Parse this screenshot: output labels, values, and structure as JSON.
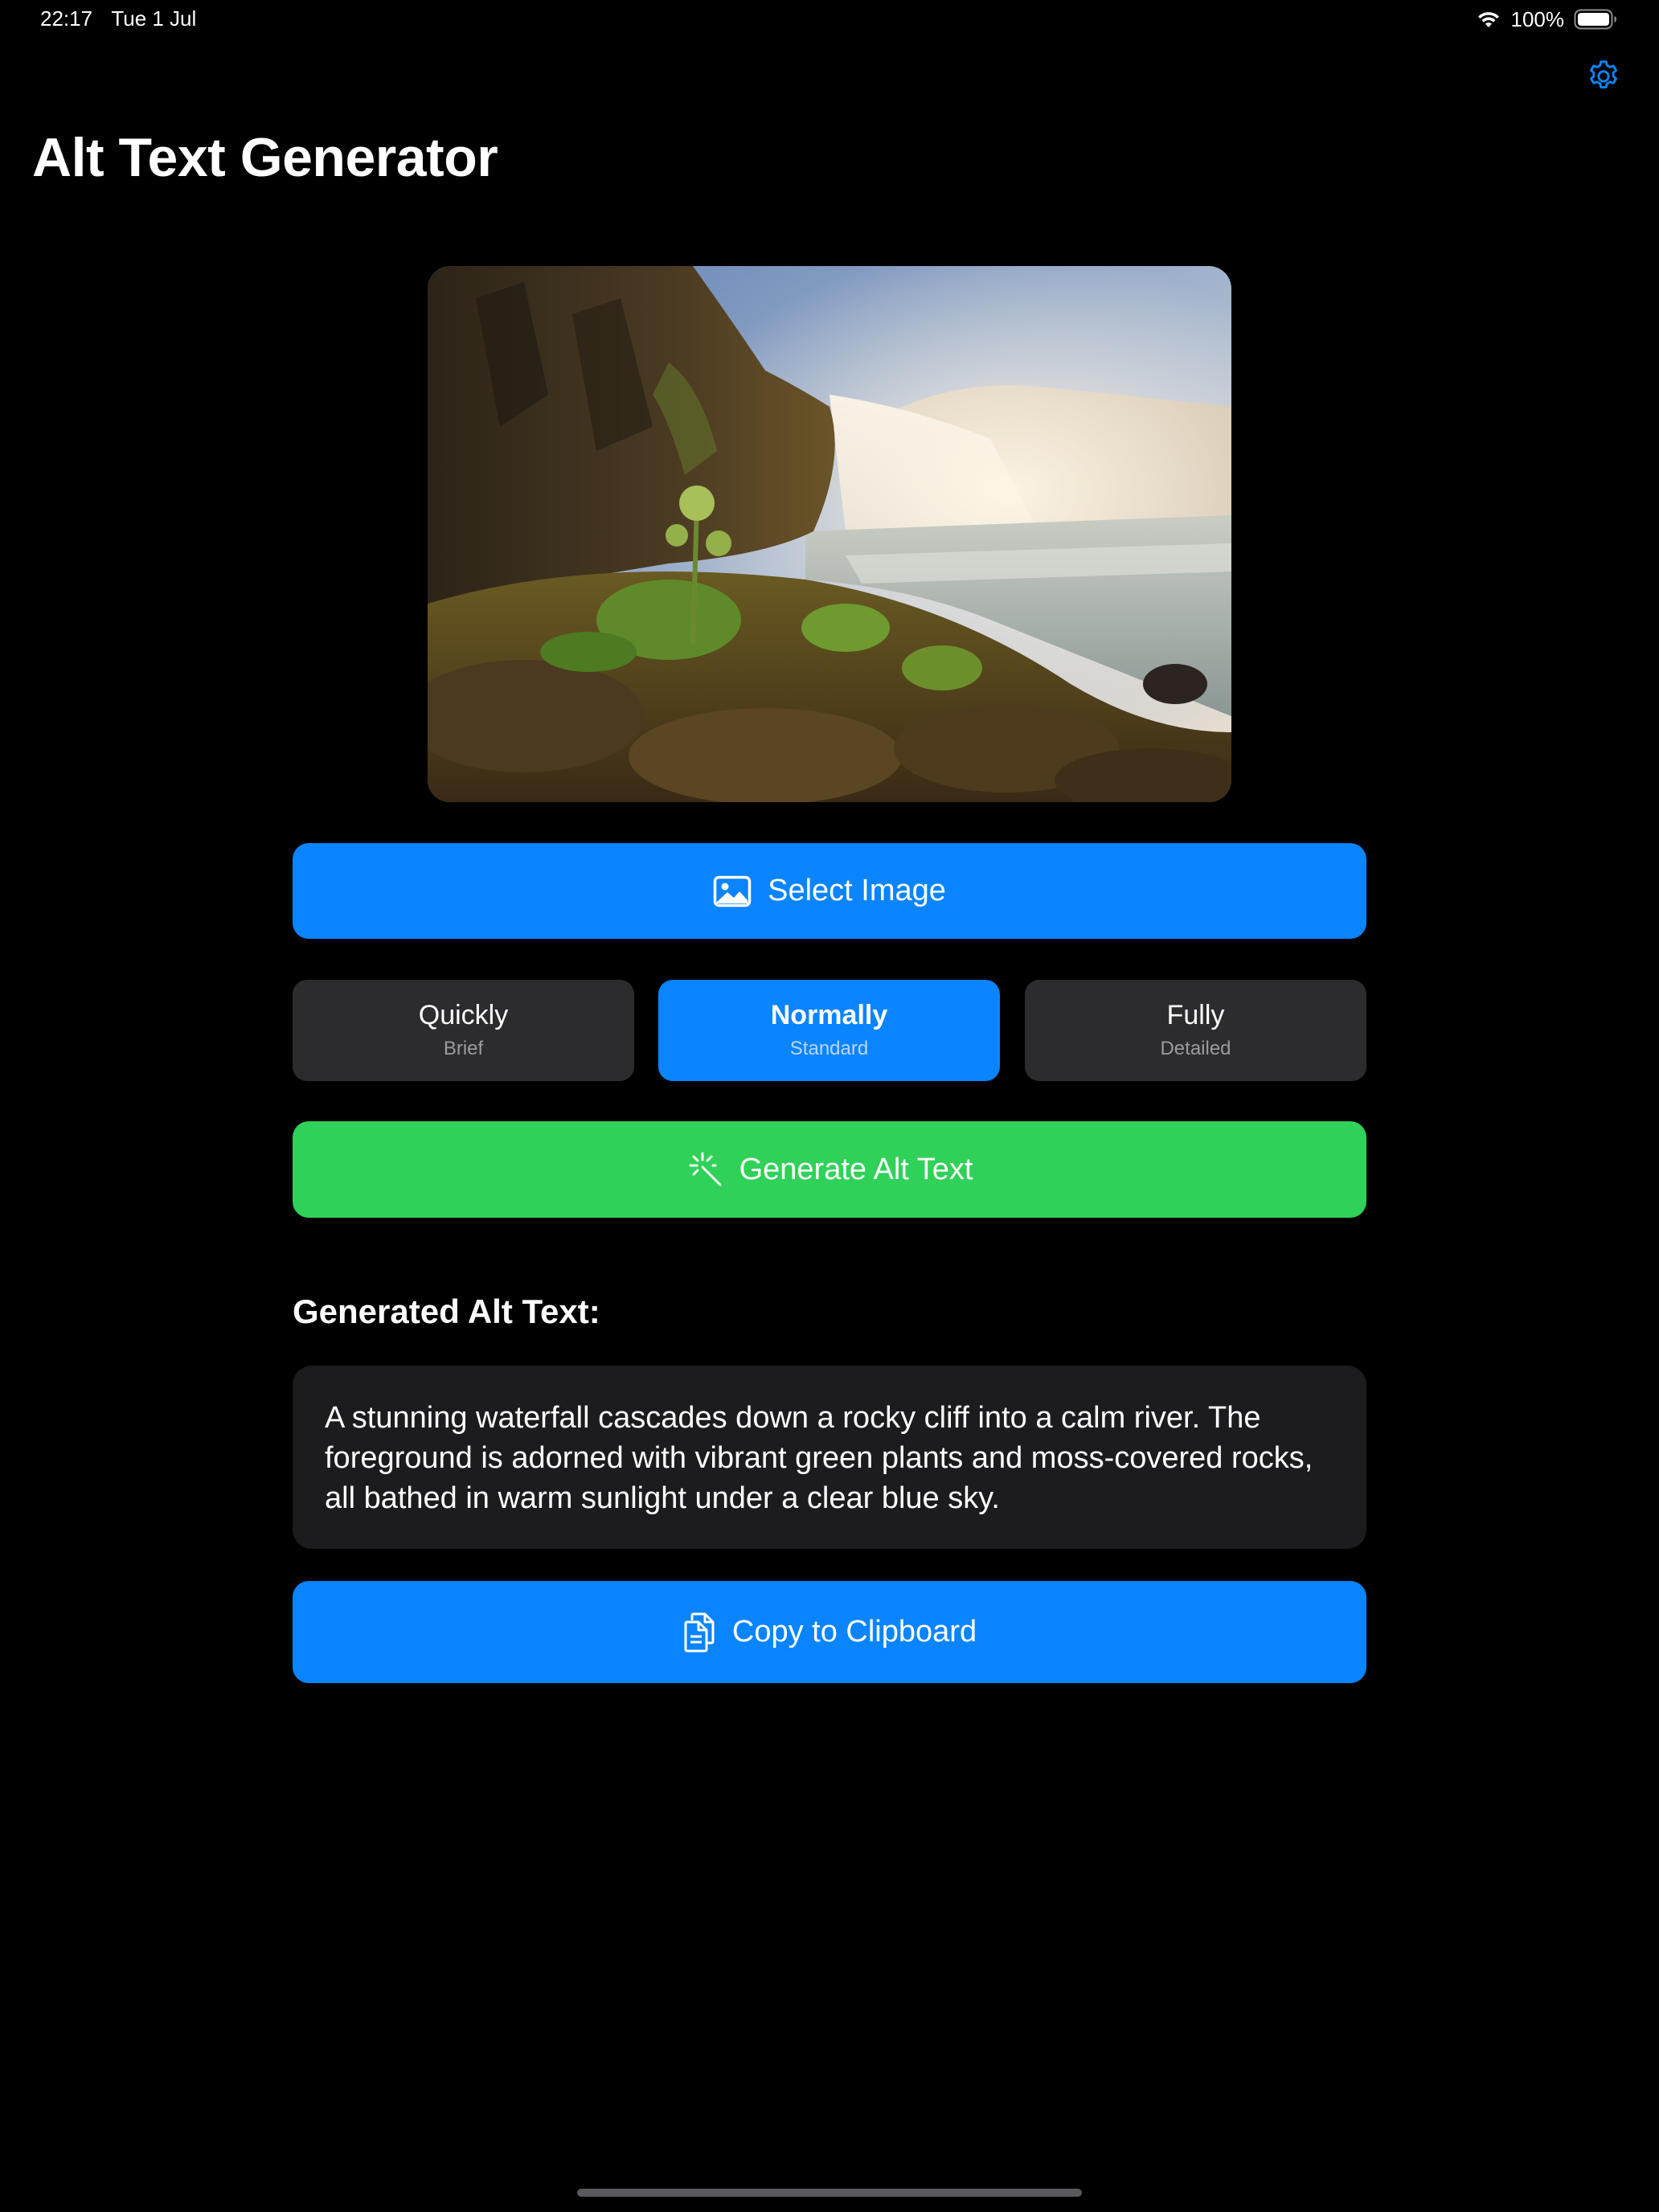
{
  "status_bar": {
    "time": "22:17",
    "date": "Tue 1 Jul",
    "battery": "100%",
    "icons": [
      "wifi-icon",
      "battery-icon"
    ]
  },
  "header": {
    "title": "Alt Text Generator",
    "settings_icon": "gear-icon"
  },
  "preview": {
    "icon": "photo"
  },
  "actions": {
    "select_label": "Select Image",
    "select_icon": "photo-icon",
    "generate_label": "Generate Alt Text",
    "generate_icon": "sparkle-icon",
    "copy_label": "Copy to Clipboard",
    "copy_icon": "documents-icon"
  },
  "detail_levels": [
    {
      "title": "Quickly",
      "subtitle": "Brief",
      "selected": false
    },
    {
      "title": "Normally",
      "subtitle": "Standard",
      "selected": true
    },
    {
      "title": "Fully",
      "subtitle": "Detailed",
      "selected": false
    }
  ],
  "result": {
    "heading": "Generated Alt Text:",
    "text": "A stunning waterfall cascades down a rocky cliff into a calm river. The foreground is adorned with vibrant green plants and moss-covered rocks, all bathed in warm sunlight under a clear blue sky."
  },
  "colors": {
    "accent": "#0a84ff",
    "generate": "#30d158",
    "background": "#000000",
    "card": "#1c1c1e",
    "segment": "#2c2c2e"
  }
}
